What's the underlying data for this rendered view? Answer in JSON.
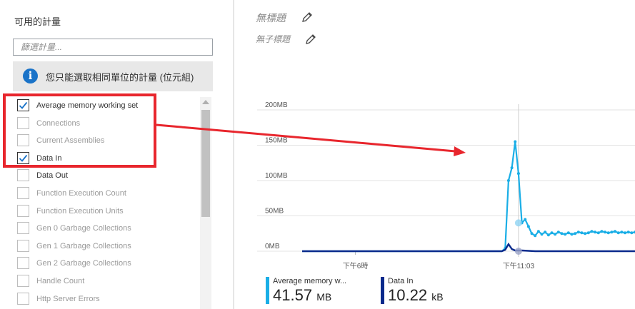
{
  "left_panel": {
    "title": "可用的計量",
    "filter_placeholder": "篩選計量...",
    "info_text": "您只能選取相同單位的計量 (位元組)",
    "metrics": [
      {
        "label": "Average memory working set",
        "checked": true
      },
      {
        "label": "Connections",
        "checked": false
      },
      {
        "label": "Current Assemblies",
        "checked": false
      },
      {
        "label": "Data In",
        "checked": true
      },
      {
        "label": "Data Out",
        "checked": false
      },
      {
        "label": "Function Execution Count",
        "checked": false
      },
      {
        "label": "Function Execution Units",
        "checked": false
      },
      {
        "label": "Gen 0 Garbage Collections",
        "checked": false
      },
      {
        "label": "Gen 1 Garbage Collections",
        "checked": false
      },
      {
        "label": "Gen 2 Garbage Collections",
        "checked": false
      },
      {
        "label": "Handle Count",
        "checked": false
      },
      {
        "label": "Http Server Errors",
        "checked": false
      }
    ]
  },
  "chart_header": {
    "title": "無標題",
    "subtitle": "無子標題"
  },
  "colors": {
    "accent": "#1a73c8",
    "series_memory": "#1aaee6",
    "series_datain": "#0a2a8c",
    "annotation": "#e8262d"
  },
  "chart_data": {
    "type": "line",
    "y_ticks": [
      "200MB",
      "150MB",
      "100MB",
      "50MB",
      "0MB"
    ],
    "ylim": [
      0,
      200
    ],
    "x_ticks": [
      "下午6時",
      "下午11:03"
    ],
    "series": [
      {
        "name": "Average memory w...",
        "value": "41.57",
        "unit": "MB",
        "points": [
          [
            0,
            0
          ],
          [
            1,
            0
          ],
          [
            2,
            0
          ],
          [
            3,
            0
          ],
          [
            4,
            0
          ],
          [
            5,
            0
          ],
          [
            6,
            0
          ],
          [
            7,
            0
          ],
          [
            8,
            0
          ],
          [
            9,
            0
          ],
          [
            10,
            0
          ],
          [
            11,
            0
          ],
          [
            12,
            0
          ],
          [
            13,
            0
          ],
          [
            14,
            0
          ],
          [
            15,
            0
          ],
          [
            16,
            0
          ],
          [
            17,
            0
          ],
          [
            18,
            0
          ],
          [
            19,
            0
          ],
          [
            20,
            0
          ],
          [
            21,
            0
          ],
          [
            22,
            0
          ],
          [
            23,
            0
          ],
          [
            24,
            0
          ],
          [
            25,
            0
          ],
          [
            26,
            0
          ],
          [
            27,
            0
          ],
          [
            28,
            0
          ],
          [
            29,
            0
          ],
          [
            30,
            0
          ],
          [
            31,
            0
          ],
          [
            32,
            0
          ],
          [
            33,
            0
          ],
          [
            34,
            0
          ],
          [
            35,
            0
          ],
          [
            36,
            0
          ],
          [
            37,
            0
          ],
          [
            38,
            0
          ],
          [
            39,
            0
          ],
          [
            40,
            0
          ],
          [
            41,
            0
          ],
          [
            42,
            0
          ],
          [
            43,
            0
          ],
          [
            44,
            0
          ],
          [
            45,
            0
          ],
          [
            46,
            0
          ],
          [
            47,
            0
          ],
          [
            48,
            0
          ],
          [
            49,
            0
          ],
          [
            50,
            0
          ],
          [
            51,
            0
          ],
          [
            52,
            0
          ],
          [
            53,
            0
          ],
          [
            54,
            0
          ],
          [
            55,
            0
          ],
          [
            56,
            0
          ],
          [
            57,
            0
          ],
          [
            58,
            0
          ],
          [
            59,
            0
          ],
          [
            60,
            0
          ],
          [
            61,
            4
          ],
          [
            62,
            100
          ],
          [
            63,
            118
          ],
          [
            64,
            155
          ],
          [
            65,
            110
          ],
          [
            66,
            40
          ],
          [
            67,
            45
          ],
          [
            68,
            35
          ],
          [
            69,
            25
          ],
          [
            70,
            22
          ],
          [
            71,
            28
          ],
          [
            72,
            24
          ],
          [
            73,
            27
          ],
          [
            74,
            23
          ],
          [
            75,
            26
          ],
          [
            76,
            24
          ],
          [
            77,
            27
          ],
          [
            78,
            25
          ],
          [
            79,
            24
          ],
          [
            80,
            26
          ],
          [
            81,
            24
          ],
          [
            82,
            25
          ],
          [
            83,
            27
          ],
          [
            84,
            26
          ],
          [
            85,
            25
          ],
          [
            86,
            26
          ],
          [
            87,
            28
          ],
          [
            88,
            27
          ],
          [
            89,
            26
          ],
          [
            90,
            28
          ],
          [
            91,
            27
          ],
          [
            92,
            26
          ],
          [
            93,
            27
          ],
          [
            94,
            28
          ],
          [
            95,
            26
          ],
          [
            96,
            27
          ],
          [
            97,
            26
          ],
          [
            98,
            27
          ],
          [
            99,
            26
          ],
          [
            100,
            27
          ]
        ]
      },
      {
        "name": "Data In",
        "value": "10.22",
        "unit": "kB",
        "points": [
          [
            0,
            0
          ],
          [
            10,
            0
          ],
          [
            20,
            0
          ],
          [
            30,
            0
          ],
          [
            40,
            0
          ],
          [
            50,
            0
          ],
          [
            60,
            0
          ],
          [
            61,
            2
          ],
          [
            62,
            10
          ],
          [
            63,
            3
          ],
          [
            64,
            1
          ],
          [
            65,
            1
          ],
          [
            66,
            1
          ],
          [
            70,
            0
          ],
          [
            80,
            0
          ],
          [
            90,
            0
          ],
          [
            100,
            0
          ]
        ]
      }
    ],
    "xlim": [
      0,
      100
    ],
    "cursor_x": 65
  }
}
